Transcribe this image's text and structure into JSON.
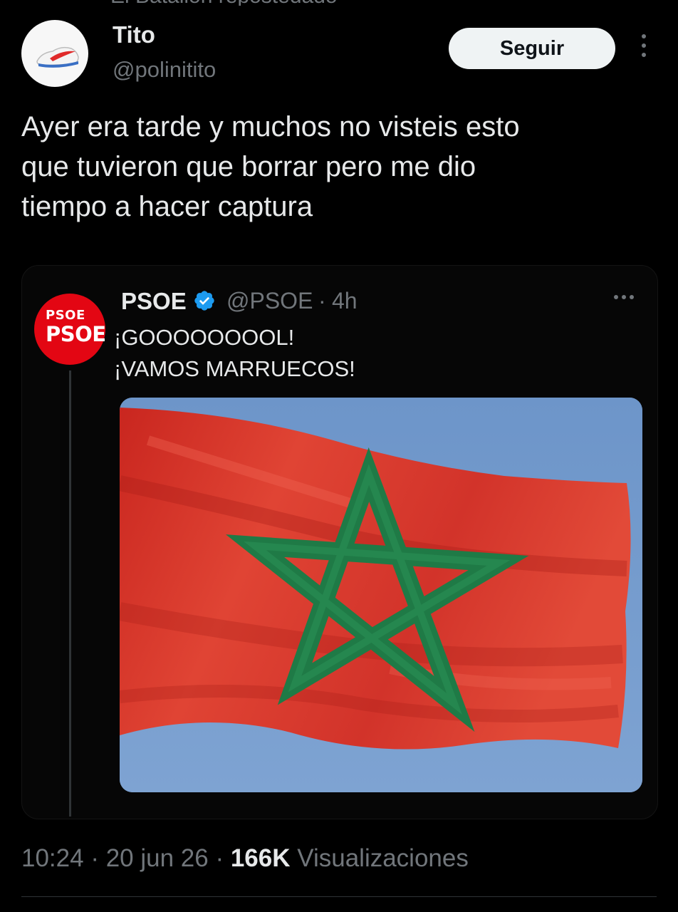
{
  "header": {
    "cut_text": "El Batallón repostedado"
  },
  "tweet": {
    "author": {
      "name": "Tito",
      "handle": "@polinitito",
      "avatar_icon": "sneaker-avatar-icon"
    },
    "follow_label": "Seguir",
    "text": "Ayer era tarde y muchos no visteis esto\nque tuvieron que borrar pero me dio\ntiempo a hacer captura"
  },
  "quote": {
    "avatar": {
      "line1": "PSOE",
      "line2": "PSOE"
    },
    "name": "PSOE",
    "handle": "@PSOE",
    "separator": "·",
    "time": "4h",
    "lines": [
      "¡GOOOOOOOOL!",
      "¡VAMOS MARRUECOS!"
    ],
    "image_icon": "morocco-flag-image"
  },
  "meta": {
    "time": "10:24",
    "sep1": " · ",
    "date": "20 jun 26",
    "sep2": " · ",
    "views": "166K",
    "views_label": "Visualizaciones"
  },
  "colors": {
    "background": "#000000",
    "follow_button": "#eff3f4",
    "verified": "#1d9bf0",
    "psoe_red": "#e30613",
    "flag_red": "#d8332a",
    "flag_green": "#1f7a46",
    "sky": "#6f96c8"
  }
}
